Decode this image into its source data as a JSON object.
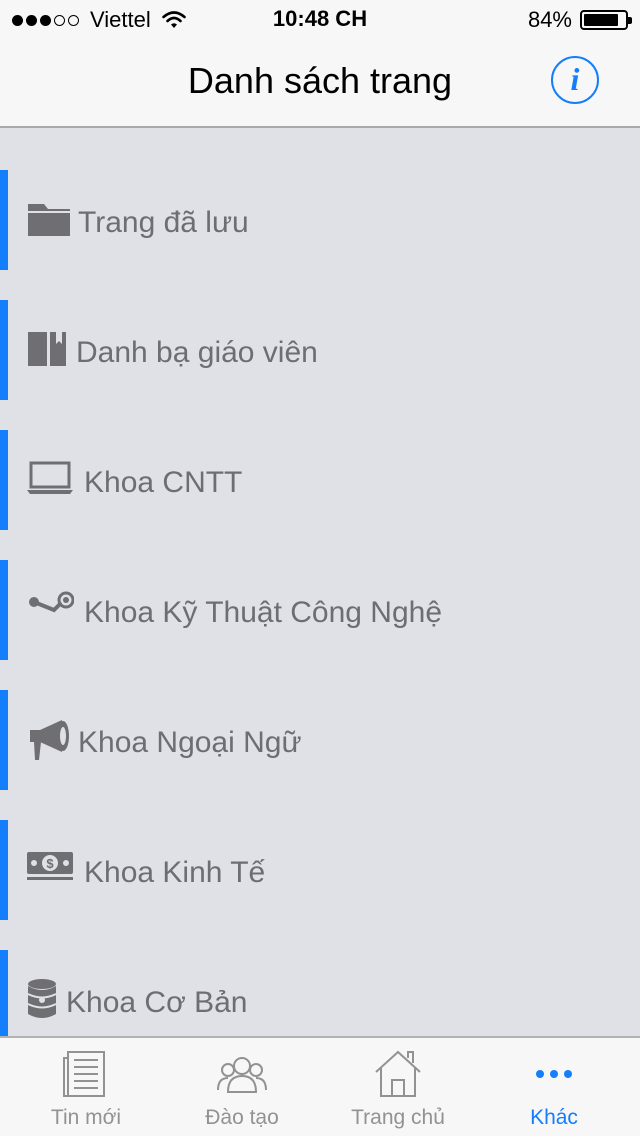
{
  "status_bar": {
    "carrier": "Viettel",
    "signal_bars_filled": 3,
    "signal_bars_total": 5,
    "time": "10:48 CH",
    "battery_percent": "84%",
    "battery_level": 0.84
  },
  "nav": {
    "title": "Danh sách trang",
    "info_icon": "info-circle-icon",
    "info_glyph": "i"
  },
  "list": {
    "items": [
      {
        "label": "Trang đã lưu",
        "icon": "folder-icon"
      },
      {
        "label": "Danh bạ giáo viên",
        "icon": "book-icon"
      },
      {
        "label": "Khoa CNTT",
        "icon": "laptop-icon"
      },
      {
        "label": "Khoa Kỹ Thuật Công Nghệ",
        "icon": "steam-icon"
      },
      {
        "label": "Khoa Ngoại Ngữ",
        "icon": "megaphone-icon"
      },
      {
        "label": "Khoa Kinh Tế",
        "icon": "money-icon"
      },
      {
        "label": "Khoa Cơ Bản",
        "icon": "database-icon"
      }
    ]
  },
  "tabs": [
    {
      "label": "Tin mới",
      "icon": "news-icon",
      "active": false
    },
    {
      "label": "Đào tạo",
      "icon": "people-icon",
      "active": false
    },
    {
      "label": "Trang chủ",
      "icon": "home-icon",
      "active": false
    },
    {
      "label": "Khác",
      "icon": "more-icon",
      "active": true
    }
  ],
  "colors": {
    "accent": "#147efb",
    "list_background": "#dfe1e7",
    "bar_background": "#f7f7f7",
    "item_text": "#6d6d72",
    "tab_inactive": "#929292"
  }
}
